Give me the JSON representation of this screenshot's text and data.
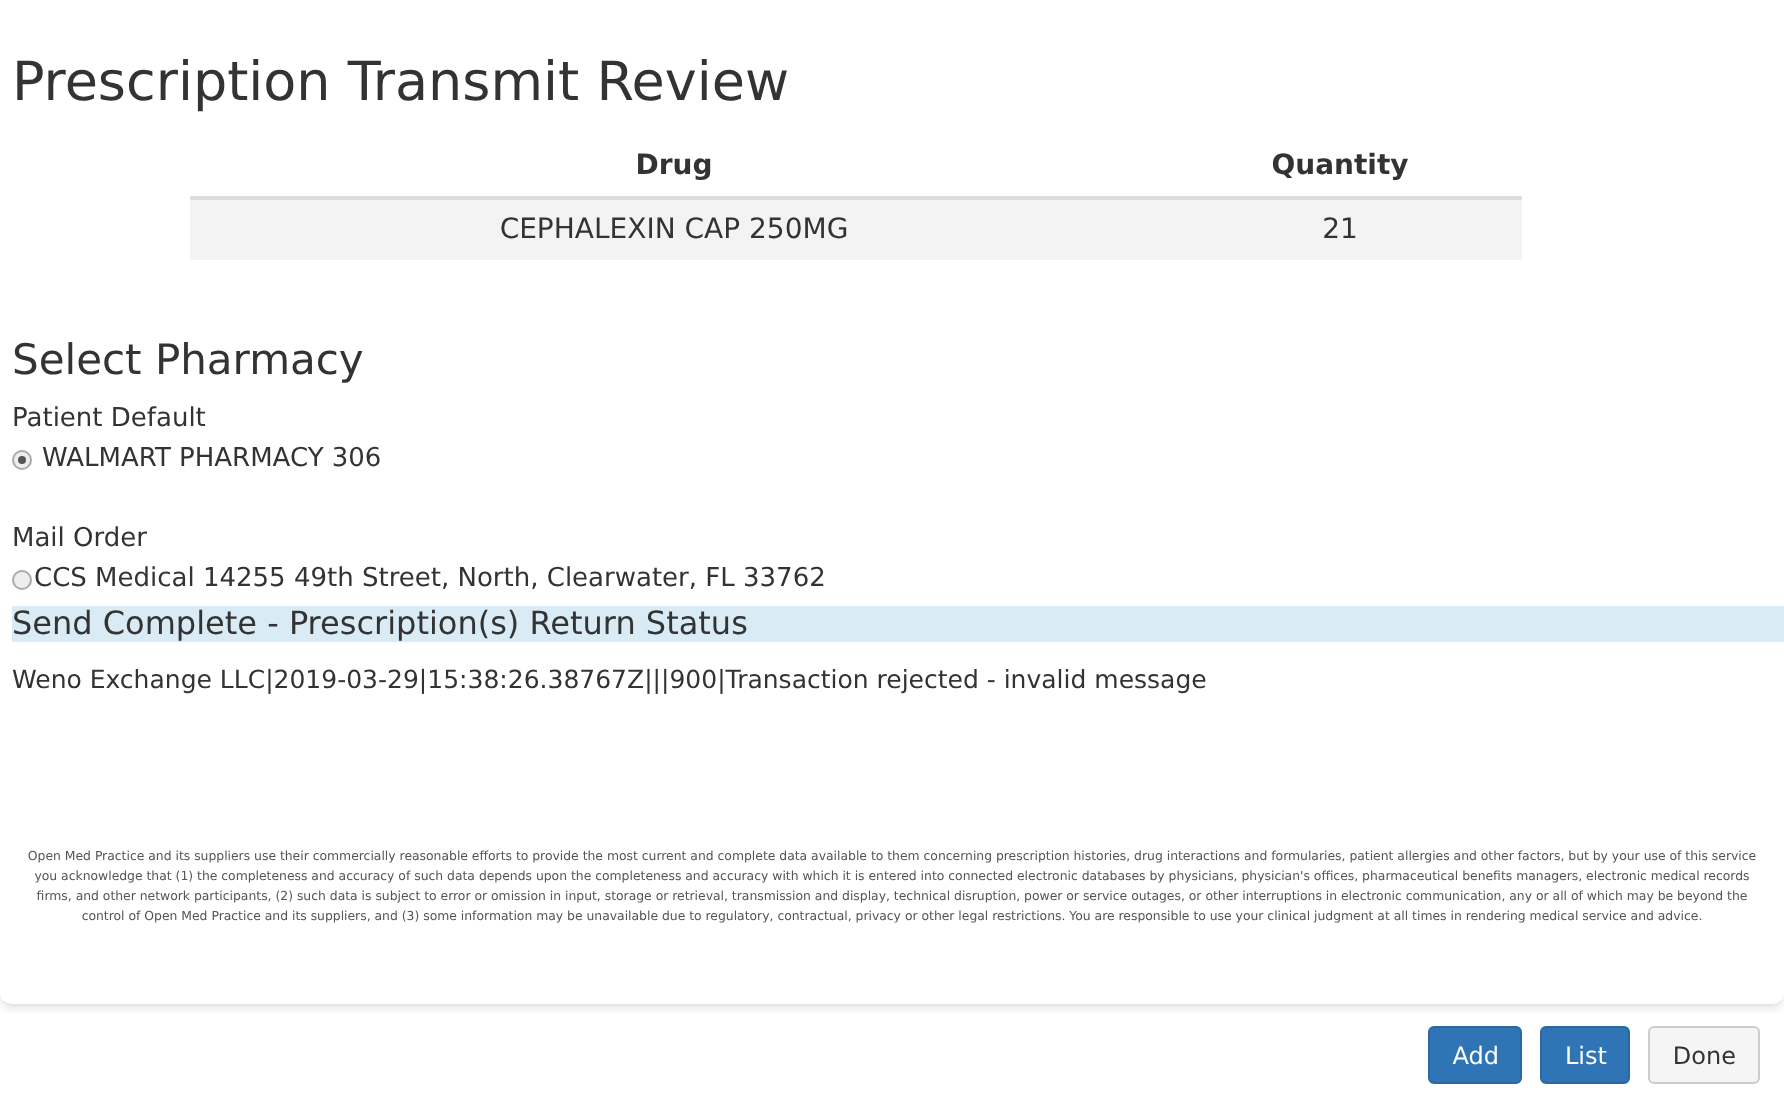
{
  "title": "Prescription Transmit Review",
  "table": {
    "columns": [
      "Drug",
      "Quantity"
    ],
    "rows": [
      {
        "cells": [
          "CEPHALEXIN CAP 250MG",
          "21"
        ]
      }
    ]
  },
  "pharmacy": {
    "heading": "Select Pharmacy",
    "groups": [
      {
        "label": "Patient Default",
        "option": {
          "text": "WALMART PHARMACY 306",
          "selected": true
        }
      },
      {
        "label": "Mail Order",
        "option": {
          "text": "CCS Medical 14255 49th Street, North, Clearwater, FL 33762",
          "selected": false
        }
      }
    ]
  },
  "status": {
    "heading": "Send Complete - Prescription(s) Return Status",
    "lines": [
      "Weno Exchange LLC|2019-03-29|15:38:26.38767Z|||900|Transaction rejected - invalid message"
    ]
  },
  "disclaimer": "Open Med Practice and its suppliers use their commercially reasonable efforts to provide the most current and complete data available to them concerning prescription histories, drug interactions and formularies, patient allergies and other factors, but by your use of this service you acknowledge that (1) the completeness and accuracy of such data depends upon the completeness and accuracy with which it is entered into connected electronic databases by physicians, physician's offices, pharmaceutical benefits managers, electronic medical records firms, and other network participants, (2) such data is subject to error or omission in input, storage or retrieval, transmission and display, technical disruption, power or service outages, or other interruptions in electronic communication, any or all of which may be beyond the control of Open Med Practice and its suppliers, and (3) some information may be unavailable due to regulatory, contractual, privacy or other legal restrictions. You are responsible to use your clinical judgment at all times in rendering medical service and advice.",
  "buttons": [
    {
      "label": "Add",
      "kind": "primary"
    },
    {
      "label": "List",
      "kind": "primary"
    },
    {
      "label": "Done",
      "kind": "default"
    }
  ]
}
